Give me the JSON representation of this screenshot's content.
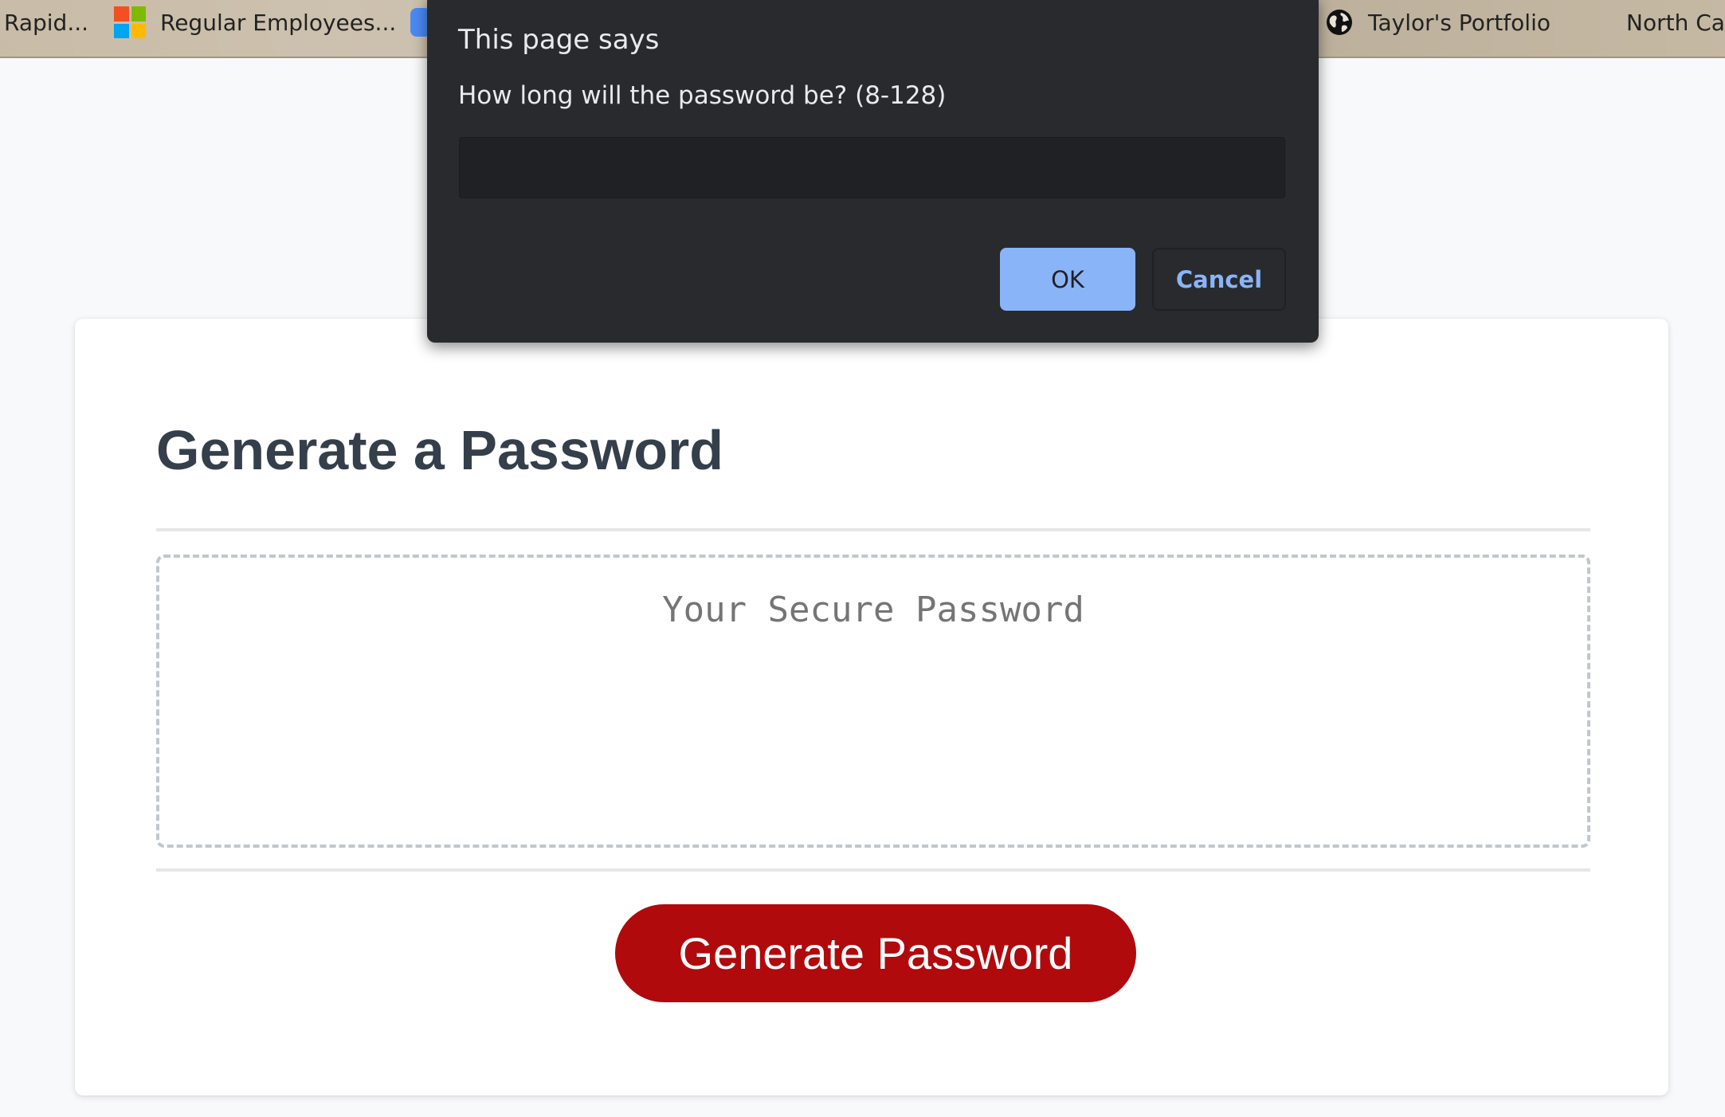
{
  "bookmarks": [
    {
      "label": "Rapid...",
      "icon": "none"
    },
    {
      "label": "Regular Employees...",
      "icon": "microsoft-logo-icon"
    },
    {
      "label": "",
      "icon": "blue-app-icon"
    },
    {
      "label": "Taylor's Portfolio",
      "icon": "globe-icon"
    },
    {
      "label": "North Car",
      "icon": "none"
    }
  ],
  "dialog": {
    "title": "This page says",
    "message": "How long will the password be? (8-128)",
    "input_value": "",
    "ok_label": "OK",
    "cancel_label": "Cancel"
  },
  "card": {
    "title": "Generate a Password",
    "password_placeholder": "Your Secure Password",
    "generate_label": "Generate Password"
  },
  "colors": {
    "generate_button": "#b00a0d",
    "title_text": "#343f4b",
    "dialog_background": "#292a2d",
    "dialog_ok": "#8ab4f8"
  }
}
